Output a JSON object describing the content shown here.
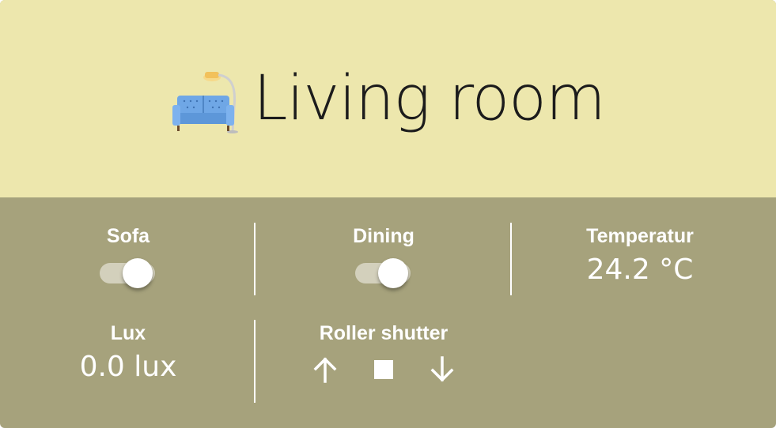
{
  "header": {
    "icon": "couch-and-lamp-icon",
    "title": "Living room"
  },
  "tiles": {
    "sofa": {
      "label": "Sofa",
      "state": "on"
    },
    "dining": {
      "label": "Dining",
      "state": "on"
    },
    "temperature": {
      "label": "Temperatur",
      "value": "24.2 °C"
    },
    "lux": {
      "label": "Lux",
      "value": "0.0 lux"
    },
    "roller_shutter": {
      "label": "Roller shutter",
      "buttons": [
        "arrow-up-icon",
        "stop-icon",
        "arrow-down-icon"
      ]
    }
  },
  "colors": {
    "header_bg": "#ede7ad",
    "body_bg": "#a6a27c",
    "text_light": "#ffffff",
    "title_text": "#1c1c1c"
  }
}
